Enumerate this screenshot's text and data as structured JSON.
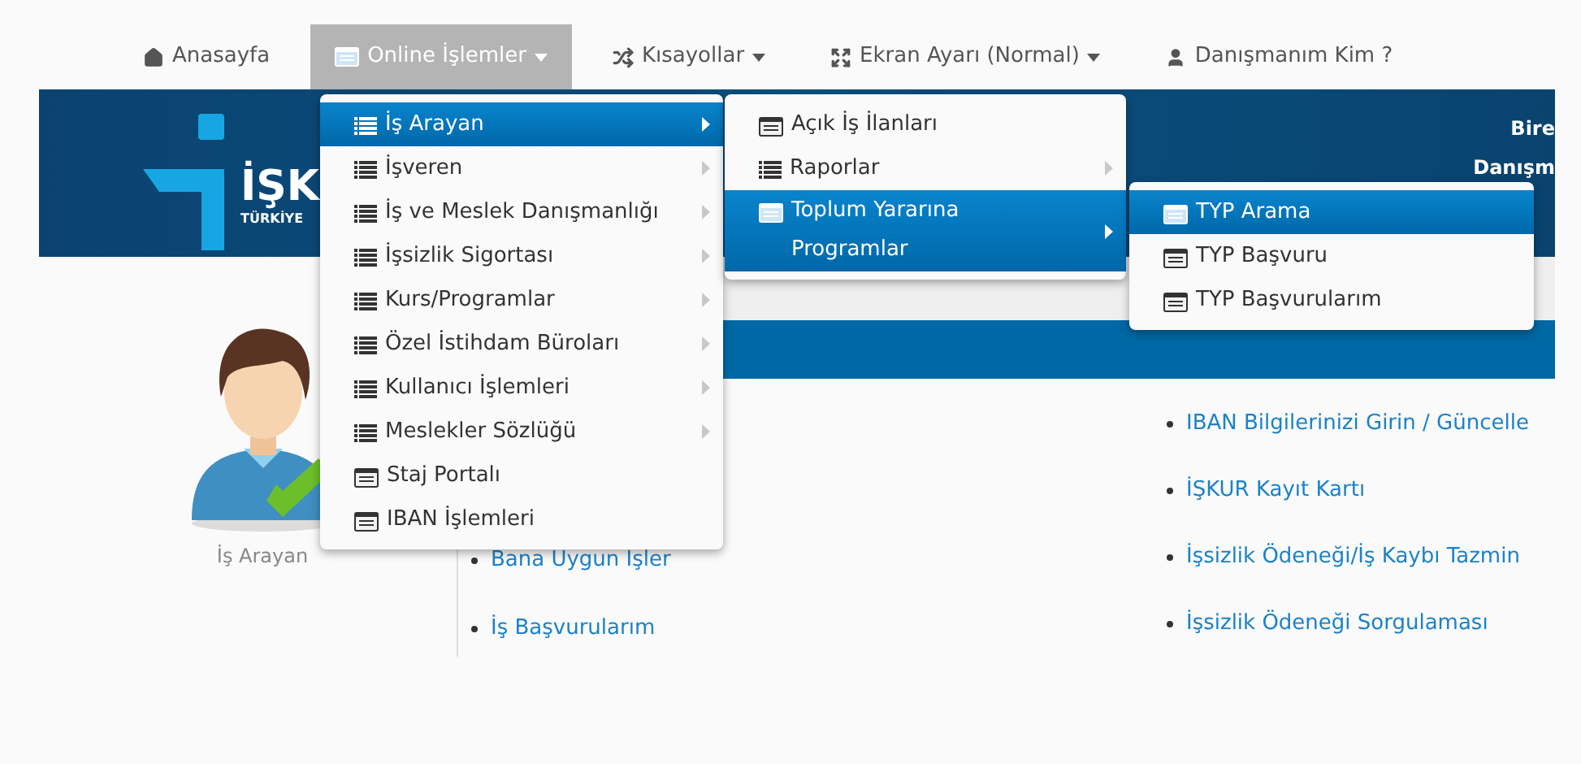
{
  "nav": [
    {
      "label": "Anasayfa",
      "kind": "home",
      "caret": false,
      "selected": false
    },
    {
      "label": "Online İşlemler",
      "kind": "card",
      "caret": true,
      "selected": true
    },
    {
      "label": "Kısayollar",
      "kind": "shuffle",
      "caret": true,
      "selected": false
    },
    {
      "label": "Ekran Ayarı (Normal)",
      "kind": "expand",
      "caret": true,
      "selected": false
    },
    {
      "label": "Danışmanım Kim ?",
      "kind": "user",
      "caret": false,
      "selected": false
    }
  ],
  "banner": {
    "logo_text": "İŞK",
    "logo_subtext": "TÜRKİYE",
    "right_lines": [
      "Bire",
      "Danışm"
    ]
  },
  "menu": [
    {
      "label": "İş Arayan",
      "kind": "list",
      "submenu": true,
      "selected": true
    },
    {
      "label": "İşveren",
      "kind": "list",
      "submenu": true,
      "selected": false
    },
    {
      "label": "İş ve Meslek Danışmanlığı",
      "kind": "list",
      "submenu": true,
      "selected": false
    },
    {
      "label": "İşsizlik Sigortası",
      "kind": "list",
      "submenu": true,
      "selected": false
    },
    {
      "label": "Kurs/Programlar",
      "kind": "list",
      "submenu": true,
      "selected": false
    },
    {
      "label": "Özel İstihdam Büroları",
      "kind": "list",
      "submenu": true,
      "selected": false
    },
    {
      "label": "Kullanıcı İşlemleri",
      "kind": "list",
      "submenu": true,
      "selected": false
    },
    {
      "label": "Meslekler Sözlüğü",
      "kind": "list",
      "submenu": true,
      "selected": false
    },
    {
      "label": "Staj Portalı",
      "kind": "card",
      "submenu": false,
      "selected": false
    },
    {
      "label": "IBAN İşlemleri",
      "kind": "card",
      "submenu": false,
      "selected": false
    }
  ],
  "submenu": [
    {
      "label": "Açık İş İlanları",
      "kind": "card",
      "submenu": false,
      "selected": false
    },
    {
      "label": "Raporlar",
      "kind": "list",
      "submenu": true,
      "selected": false
    },
    {
      "label": "Toplum Yararına Programlar",
      "kind": "card",
      "submenu": true,
      "selected": true
    }
  ],
  "submenu_2": [
    {
      "label": "TYP Arama",
      "kind": "card",
      "submenu": false,
      "selected": true
    },
    {
      "label": "TYP Başvuru",
      "kind": "card",
      "submenu": false,
      "selected": false
    },
    {
      "label": "TYP Başvurularım",
      "kind": "card",
      "submenu": false,
      "selected": false
    }
  ],
  "profile": {
    "label": "İş Arayan"
  },
  "links_left": [
    "Bana Uygun İşler",
    "İş Başvurularım"
  ],
  "links_right": [
    "IBAN Bilgilerinizi Girin / Güncelle",
    "İŞKUR Kayıt Kartı",
    "İşsizlik Ödeneği/İş Kaybı Tazmin",
    "İşsizlik Ödeneği Sorgulaması"
  ]
}
